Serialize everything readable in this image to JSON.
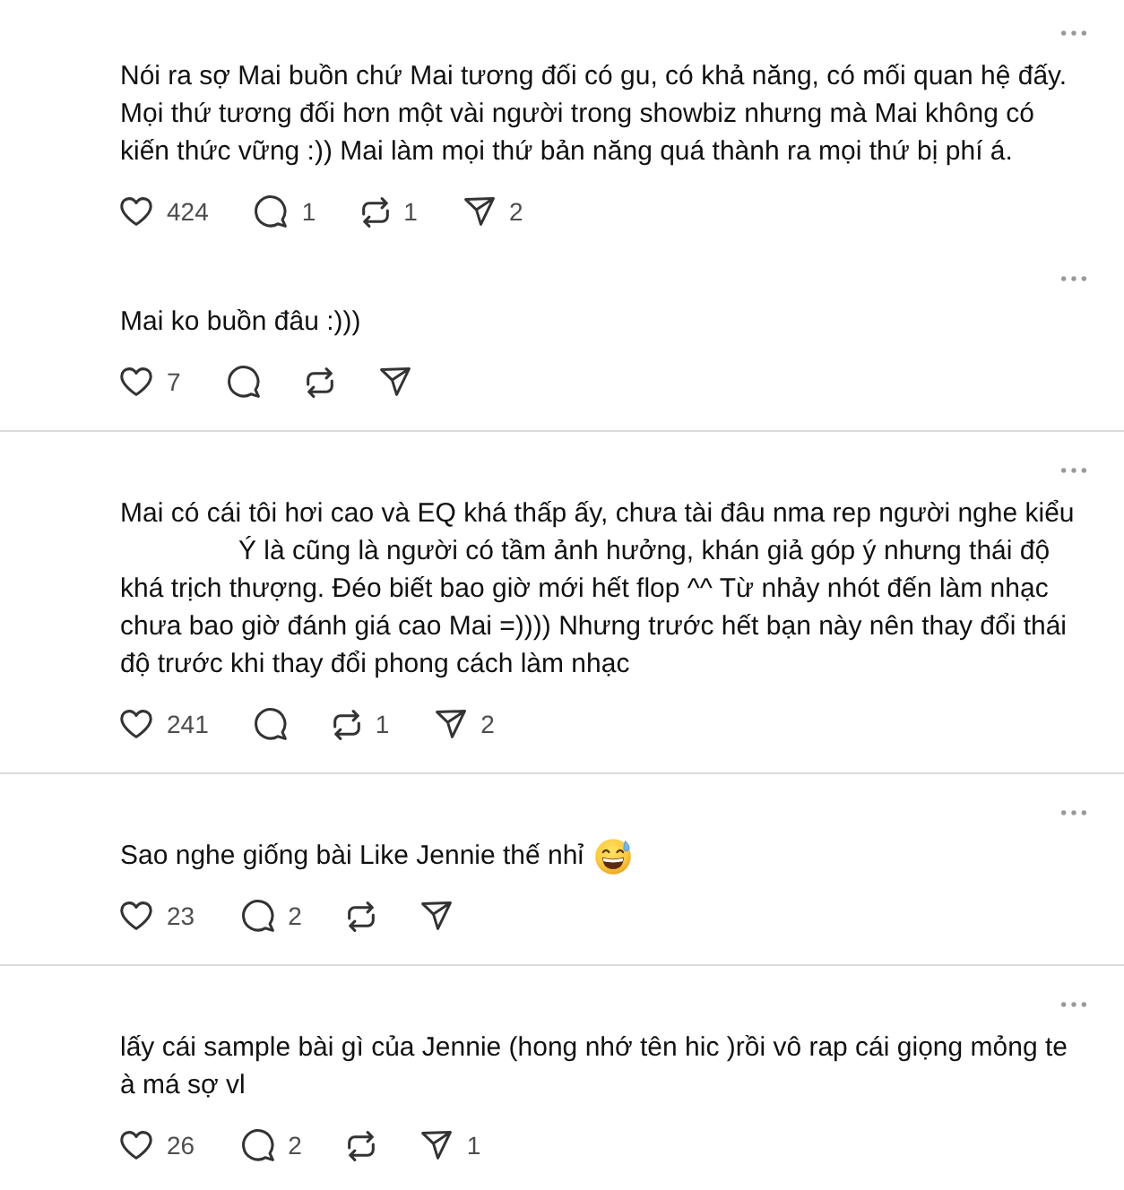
{
  "threads": [
    {
      "posts": [
        {
          "text_parts": [
            "Nói ra sợ Mai buồn chứ Mai tương đối có gu, có khả năng, có mối quan hệ đấy. Mọi thứ tương đối hơn một vài người trong showbiz nhưng mà Mai không có kiến thức vững :)) Mai làm mọi thứ bản năng quá thành ra mọi thứ bị phí á."
          ],
          "trailing_emoji": false,
          "actions": [
            {
              "kind": "like",
              "count": "424"
            },
            {
              "kind": "reply",
              "count": "1"
            },
            {
              "kind": "repost",
              "count": "1"
            },
            {
              "kind": "share",
              "count": "2"
            }
          ]
        },
        {
          "text_parts": [
            "Mai ko buồn đâu :)))"
          ],
          "trailing_emoji": false,
          "actions": [
            {
              "kind": "like",
              "count": "7"
            },
            {
              "kind": "reply"
            },
            {
              "kind": "repost"
            },
            {
              "kind": "share"
            }
          ]
        }
      ]
    },
    {
      "posts": [
        {
          "text_parts": [
            "Mai có cái tôi hơi cao và EQ khá thấp ấy, chưa tài đâu nma rep người nghe kiểu",
            "Ý là cũng là người có tầm ảnh hưởng, khán giả góp ý nhưng thái độ khá trịch thượng. Đéo biết bao giờ mới hết flop ^^ Từ nhảy nhót đến làm nhạc chưa bao giờ đánh giá cao Mai =)))) Nhưng trước hết bạn này nên thay đổi thái độ trước khi thay đổi phong cách làm nhạc"
          ],
          "trailing_emoji": false,
          "actions": [
            {
              "kind": "like",
              "count": "241"
            },
            {
              "kind": "reply"
            },
            {
              "kind": "repost",
              "count": "1"
            },
            {
              "kind": "share",
              "count": "2"
            }
          ]
        }
      ]
    },
    {
      "posts": [
        {
          "text_parts": [
            "Sao nghe giống bài Like Jennie thế nhỉ"
          ],
          "trailing_emoji": true,
          "actions": [
            {
              "kind": "like",
              "count": "23"
            },
            {
              "kind": "reply",
              "count": "2"
            },
            {
              "kind": "repost"
            },
            {
              "kind": "share"
            }
          ]
        }
      ]
    },
    {
      "posts": [
        {
          "text_parts": [
            "lấy cái sample bài gì của Jennie (hong nhớ tên hic )rồi vô rap cái giọng mỏng te à má sợ vl"
          ],
          "trailing_emoji": false,
          "actions": [
            {
              "kind": "like",
              "count": "26"
            },
            {
              "kind": "reply",
              "count": "2"
            },
            {
              "kind": "repost"
            },
            {
              "kind": "share",
              "count": "1"
            }
          ]
        }
      ]
    }
  ]
}
